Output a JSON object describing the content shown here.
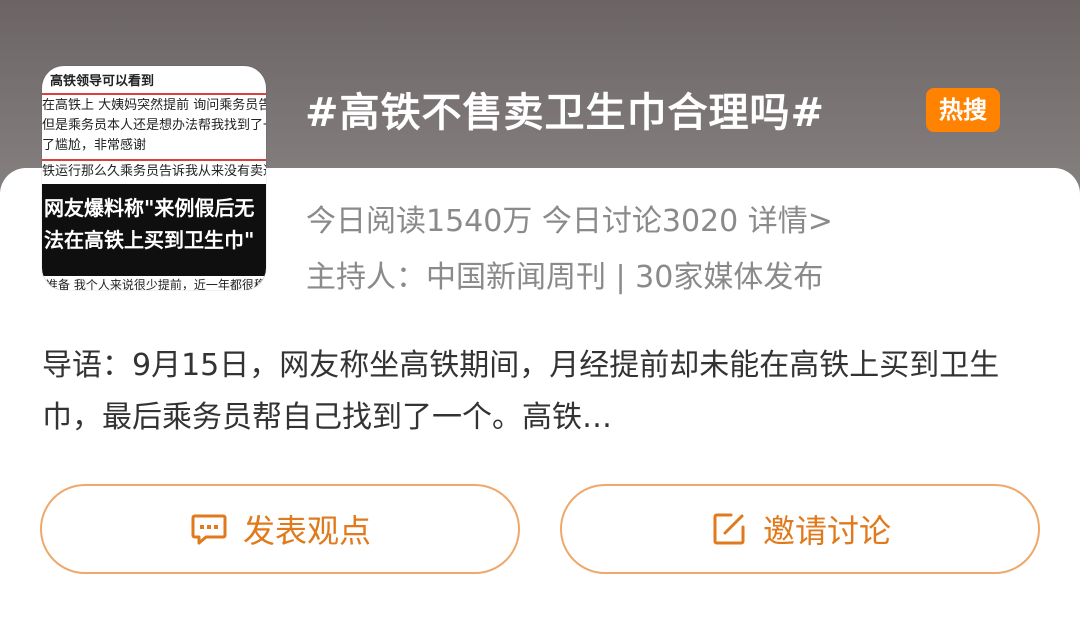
{
  "topic": {
    "title": "#高铁不售卖卫生巾合理吗#",
    "badge": "热搜",
    "stats": "今日阅读1540万  今日讨论3020  详情>",
    "host": "主持人：中国新闻周刊 | 30家媒体发布"
  },
  "thumbnail": {
    "lines": [
      "高铁领导可以看到",
      "在高铁上 大姨妈突然提前 询问乘务员告知",
      "但是乘务员本人还是想办法帮我找到了一个",
      "了尴尬，非常感谢",
      "铁运行那么久乘务员告诉我从来没有卖过"
    ],
    "headline_line1": "网友爆料称\"来例假后无",
    "headline_line2": "法在高铁上买到卫生巾\"",
    "bottom_text": "准备   我个人来说很少提前，近一年都很稳"
  },
  "intro": "导语：9月15日，网友称坐高铁期间，月经提前却未能在高铁上买到卫生巾，最后乘务员帮自己找到了一个。高铁…",
  "actions": {
    "post_label": "发表观点",
    "invite_label": "邀请讨论"
  },
  "colors": {
    "accent": "#ff8200",
    "button_text": "#e07a1c",
    "button_border": "#f0a86a"
  },
  "icons": {
    "post": "comment-bubble-icon",
    "invite": "edit-icon"
  }
}
